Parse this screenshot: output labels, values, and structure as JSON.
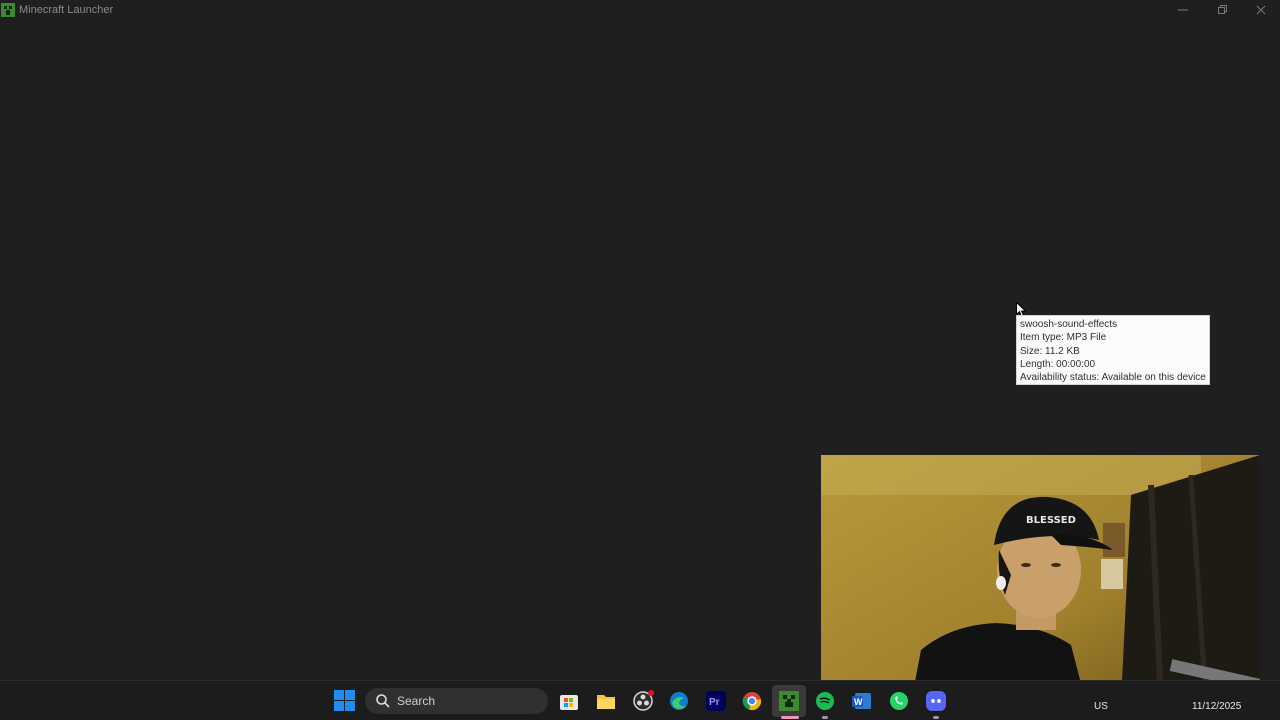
{
  "window": {
    "title": "Minecraft Launcher",
    "icon": "minecraft-icon",
    "controls": [
      "minimize-icon",
      "maximize-icon",
      "close-icon"
    ]
  },
  "tooltip": {
    "name": "swoosh-sound-effects",
    "type": "Item type: MP3 File",
    "size": "Size: 11.2 KB",
    "length": "Length: 00:00:00",
    "availability": "Availability status: Available on this device"
  },
  "taskbar": {
    "search_label": "Search",
    "apps": [
      "windows-start-icon",
      "microsoft-store-icon",
      "file-explorer-icon",
      "obs-icon",
      "edge-icon",
      "premiere-pro-icon",
      "chrome-icon",
      "minecraft-launcher-icon",
      "spotify-icon",
      "word-icon",
      "whatsapp-icon",
      "discord-icon"
    ],
    "active_app": "minecraft-launcher-icon",
    "tray": {
      "language": "US",
      "date": "11/12/2025"
    }
  },
  "colors": {
    "background": "#1f1f1f",
    "taskbar": "#1c1c1c",
    "accent": "#1f8df0",
    "active_indicator": "#e89ab9"
  }
}
